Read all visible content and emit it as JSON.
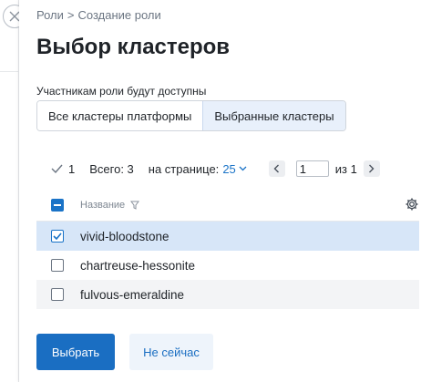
{
  "breadcrumb": {
    "parent": "Роли",
    "separator": ">",
    "current": "Создание роли"
  },
  "title": "Выбор кластеров",
  "access_label": "Участникам роли будут доступны",
  "toggle": {
    "options": [
      {
        "label": "Все кластеры платформы",
        "active": false
      },
      {
        "label": "Выбранные кластеры",
        "active": true
      }
    ]
  },
  "pager": {
    "selected_count": "1",
    "total_label": "Всего: 3",
    "per_page_label": "на странице:",
    "per_page_value": "25",
    "page_value": "1",
    "of_label": "из",
    "total_pages": "1"
  },
  "table": {
    "column_name": "Название",
    "rows": [
      {
        "name": "vivid-bloodstone",
        "checked": true
      },
      {
        "name": "chartreuse-hessonite",
        "checked": false
      },
      {
        "name": "fulvous-emeraldine",
        "checked": false
      }
    ]
  },
  "actions": {
    "primary": "Выбрать",
    "secondary": "Не сейчас"
  },
  "colors": {
    "accent": "#1a6ec2",
    "selected_row": "#d7e6f8",
    "toggle_active": "#e8f0fb"
  },
  "icons": [
    "close-icon",
    "checkmark-icon",
    "chevron-down-icon",
    "chevron-left-icon",
    "chevron-right-icon",
    "filter-icon",
    "gear-icon"
  ]
}
